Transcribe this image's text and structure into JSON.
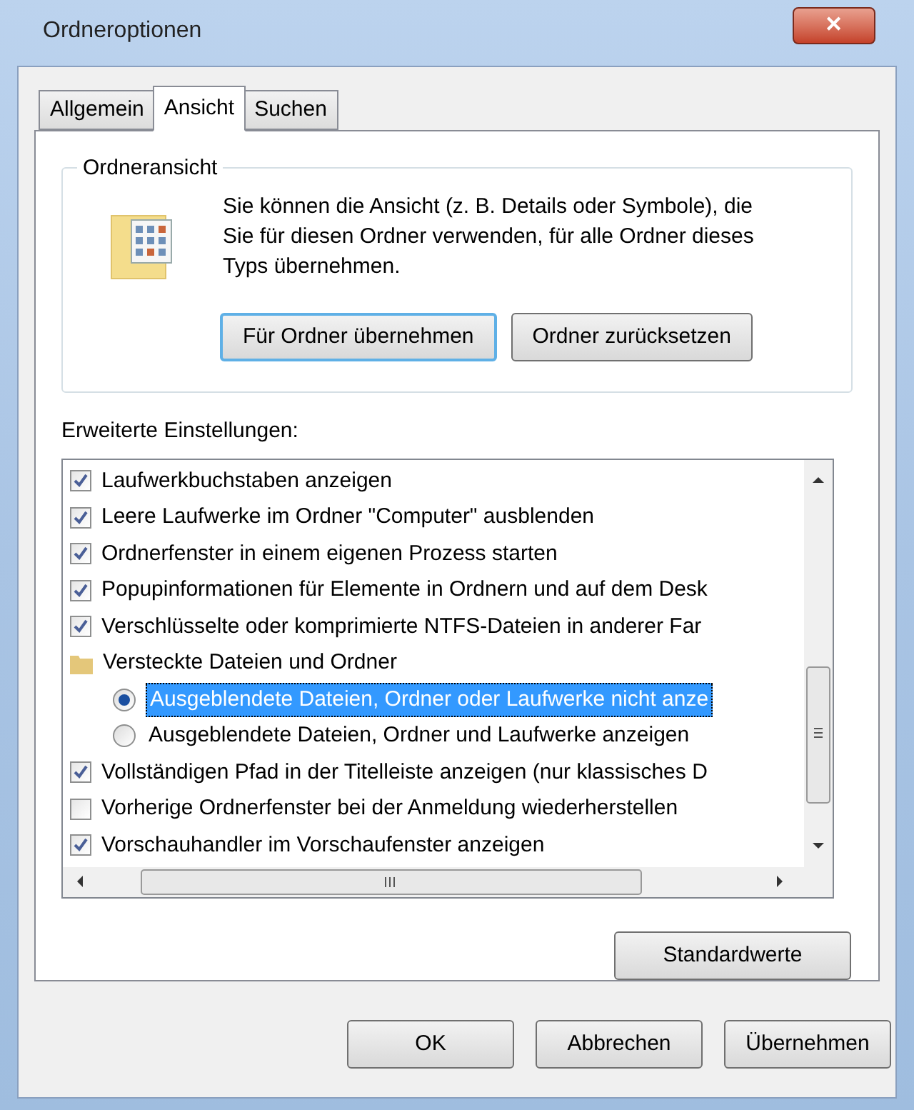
{
  "window": {
    "title": "Ordneroptionen",
    "close": "✕"
  },
  "tabs": [
    {
      "label": "Allgemein",
      "selected": false
    },
    {
      "label": "Ansicht",
      "selected": true
    },
    {
      "label": "Suchen",
      "selected": false
    }
  ],
  "folder_view": {
    "title": "Ordneransicht",
    "description": "Sie können die Ansicht (z. B. Details oder Symbole), die Sie für diesen Ordner verwenden, für alle Ordner dieses Typs übernehmen.",
    "buttons": [
      {
        "label": "Für Ordner übernehmen",
        "focused": true
      },
      {
        "label": "Ordner zurücksetzen",
        "focused": false
      }
    ]
  },
  "advanced": {
    "label": "Erweiterte Einstellungen:",
    "items": [
      {
        "kind": "checkbox",
        "label": "Laufwerkbuchstaben anzeigen",
        "checked": true
      },
      {
        "kind": "checkbox",
        "label": "Leere Laufwerke im Ordner \"Computer\" ausblenden",
        "checked": true
      },
      {
        "kind": "checkbox",
        "label": "Ordnerfenster in einem eigenen Prozess starten",
        "checked": true
      },
      {
        "kind": "checkbox",
        "label": "Popupinformationen für Elemente in Ordnern und auf dem Desk",
        "checked": true
      },
      {
        "kind": "checkbox",
        "label": "Verschlüsselte oder komprimierte NTFS-Dateien in anderer Far",
        "checked": true
      },
      {
        "kind": "folder",
        "label": "Versteckte Dateien und Ordner",
        "children": [
          {
            "kind": "radio",
            "label": "Ausgeblendete Dateien, Ordner oder Laufwerke nicht anze",
            "selected": true
          },
          {
            "kind": "radio",
            "label": "Ausgeblendete Dateien, Ordner und Laufwerke anzeigen",
            "selected": false
          }
        ]
      },
      {
        "kind": "checkbox",
        "label": "Vollständigen Pfad in der Titelleiste anzeigen (nur klassisches D",
        "checked": true
      },
      {
        "kind": "checkbox",
        "label": "Vorherige Ordnerfenster bei der Anmeldung wiederherstellen",
        "checked": false
      },
      {
        "kind": "checkbox",
        "label": "Vorschauhandler im Vorschaufenster anzeigen",
        "checked": true
      }
    ]
  },
  "defaults_button": "Standardwerte",
  "buttons": [
    "OK",
    "Abbrechen",
    "Übernehmen"
  ]
}
